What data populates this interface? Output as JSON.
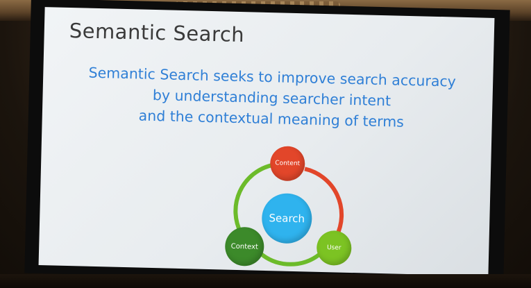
{
  "slide": {
    "title": "Semantic Search",
    "tagline": [
      "Semantic Search seeks to improve search accuracy",
      "by understanding searcher intent",
      "and the contextual meaning of terms"
    ],
    "diagram": {
      "center": "Search",
      "content": "Content",
      "user": "User",
      "context": "Context"
    }
  },
  "colors": {
    "title": "#3a3a3a",
    "tagline": "#2f7fd6",
    "search_node": "#2fb3ee",
    "content_node": "#e2462a",
    "user_node": "#7cc323",
    "context_node": "#3c8a2a",
    "arc_red": "#e2462a",
    "arc_green": "#6cbb2a"
  }
}
